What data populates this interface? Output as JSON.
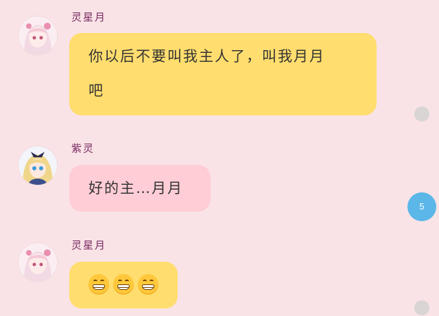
{
  "messages": [
    {
      "sender": "灵星月",
      "avatar": "anime-girl-pink-avatar",
      "bubble_color": "#ffdd6e",
      "line1": "你以后不要叫我主人了，叫我月月",
      "line2": "吧"
    },
    {
      "sender": "紫灵",
      "avatar": "anime-girl-blue-avatar",
      "bubble_color": "#ffcdd6",
      "text": "好的主…月月"
    },
    {
      "sender": "灵星月",
      "avatar": "anime-girl-pink-avatar",
      "bubble_color": "#ffdd6e",
      "emojis": [
        "grinning-face",
        "grinning-face",
        "grinning-face"
      ]
    }
  ],
  "unread_badge": "5",
  "colors": {
    "background": "#f9e3e6",
    "yellow_bubble": "#ffdd6e",
    "pink_bubble": "#ffcdd6",
    "badge": "#5ab7e8",
    "name": "#7a2a63"
  }
}
